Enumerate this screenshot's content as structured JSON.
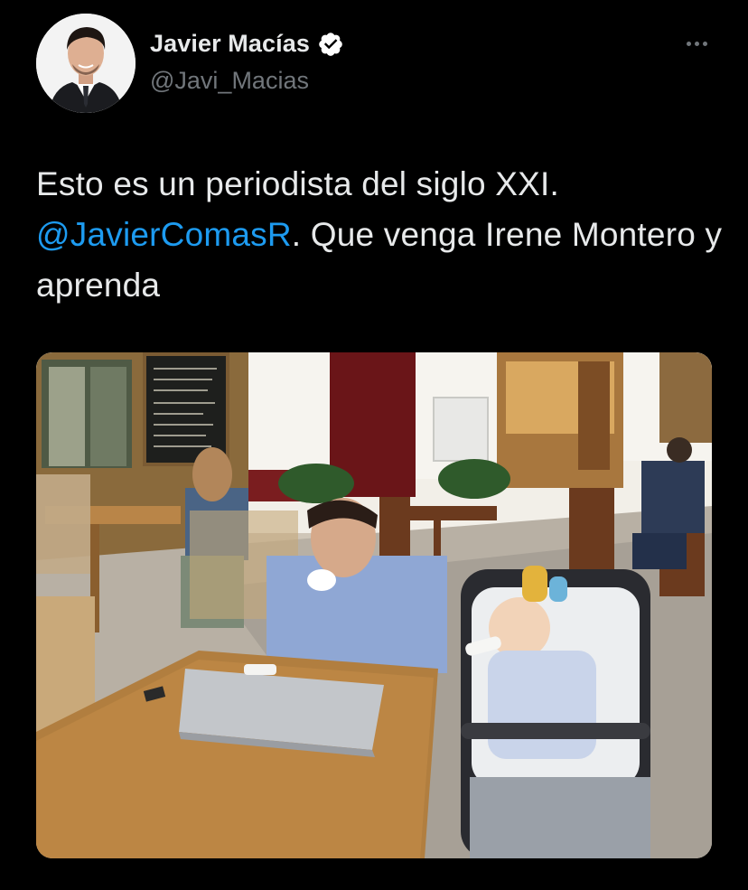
{
  "tweet": {
    "author": {
      "display_name": "Javier Macías",
      "handle": "@Javi_Macias",
      "verified": true,
      "verified_icon": "verified-badge-icon",
      "avatar_icon": "avatar-photo"
    },
    "more_icon": "more-options-icon",
    "text": {
      "part1": "Esto es un periodista del siglo XXI.",
      "mention": "@JavierComasR",
      "part2": ". Que venga Irene Montero y aprenda"
    },
    "media": {
      "type": "photo",
      "description_icon": "cafe-terrace-photo"
    }
  },
  "colors": {
    "background": "#000000",
    "text": "#e7e9ea",
    "secondary": "#71767b",
    "link": "#1d9bf0",
    "verified": "#ffffff"
  }
}
